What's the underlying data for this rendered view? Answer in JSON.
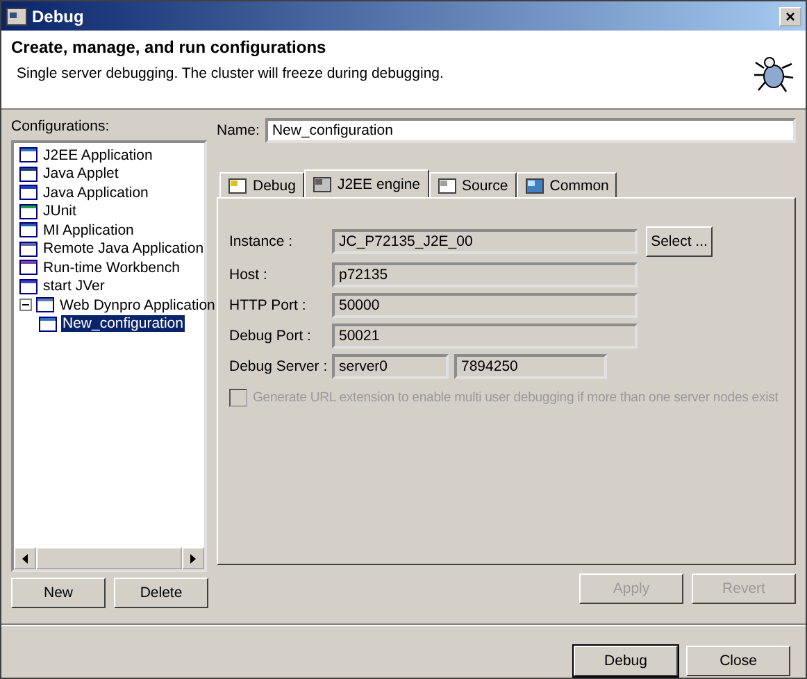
{
  "window": {
    "title": "Debug",
    "close": "×"
  },
  "header": {
    "title": "Create, manage, and run configurations",
    "message": "Single server debugging. The cluster will freeze during debugging."
  },
  "configurations": {
    "label": "Configurations:",
    "items": [
      {
        "label": "J2EE Application",
        "selected": false
      },
      {
        "label": "Java Applet",
        "selected": false
      },
      {
        "label": "Java Application",
        "selected": false
      },
      {
        "label": "JUnit",
        "selected": false
      },
      {
        "label": "MI Application",
        "selected": false
      },
      {
        "label": "Remote Java Application",
        "selected": false
      },
      {
        "label": "Run-time Workbench",
        "selected": false
      },
      {
        "label": "start JVer",
        "selected": false
      },
      {
        "label": "Web Dynpro Application",
        "selected": false,
        "expanded": true,
        "children": [
          {
            "label": "New_configuration",
            "selected": true
          }
        ]
      }
    ],
    "buttons": [
      "New",
      "Delete"
    ]
  },
  "name": {
    "label": "Name:",
    "value": "New_configuration"
  },
  "tabs": [
    {
      "label": "Debug",
      "selected": false
    },
    {
      "label": "J2EE engine",
      "selected": true
    },
    {
      "label": "Source",
      "selected": false
    },
    {
      "label": "Common",
      "selected": false
    }
  ],
  "fields": [
    {
      "label": "Instance :",
      "values": [
        "JC_P72135_J2E_00"
      ],
      "button": "Select ..."
    },
    {
      "label": "Host :",
      "values": [
        "p72135"
      ]
    },
    {
      "label": "HTTP Port :",
      "values": [
        "50000"
      ]
    },
    {
      "label": "Debug Port :",
      "values": [
        "50021"
      ]
    },
    {
      "label": "Debug Server :",
      "values": [
        "server0",
        "7894250"
      ]
    }
  ],
  "option": {
    "label": "Generate URL extension to enable multi user debugging if more than one server nodes exist",
    "checked": false,
    "disabled": true
  },
  "panel_buttons": [
    {
      "label": "Apply",
      "disabled": true
    },
    {
      "label": "Revert",
      "disabled": true
    }
  ],
  "dialog_buttons": [
    {
      "label": "Debug",
      "default": true
    },
    {
      "label": "Close",
      "default": false
    }
  ]
}
